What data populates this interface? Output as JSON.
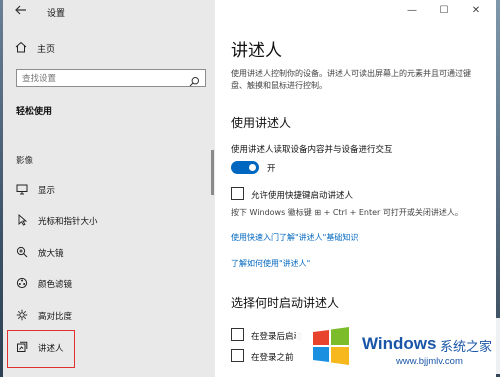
{
  "window": {
    "title": "设置",
    "controls": {
      "minimize": "—",
      "maximize": "☐",
      "close": "✕"
    }
  },
  "nav": {
    "home_label": "主页",
    "search_placeholder": "查找设置",
    "section_title": "轻松使用",
    "group_label": "影像",
    "items": [
      {
        "label": "显示",
        "icon": "display-icon"
      },
      {
        "label": "光标和指针大小",
        "icon": "cursor-icon"
      },
      {
        "label": "放大镜",
        "icon": "magnifier-icon"
      },
      {
        "label": "颜色滤镜",
        "icon": "color-filter-icon"
      },
      {
        "label": "高对比度",
        "icon": "high-contrast-icon"
      },
      {
        "label": "讲述人",
        "icon": "narrator-icon",
        "selected": true
      }
    ]
  },
  "content": {
    "title": "讲述人",
    "description": "使用讲述人控制你的设备。讲述人可读出屏幕上的元素并且可通过键盘、触摸和鼠标进行控制。",
    "section1_title": "使用讲述人",
    "toggle_description": "使用讲述人读取设备内容并与设备进行交互",
    "toggle_state": "开",
    "toggle_on": true,
    "shortcut_checkbox_label": "允许使用快捷键启动讲述人",
    "shortcut_checked": false,
    "shortcut_note": "按下 Windows 徽标键 ⊞ + Ctrl + Enter 可打开或关闭讲述人。",
    "link_quickstart": "使用快速入门了解\"讲述人\"基础知识",
    "link_learn_more": "了解如何使用\"讲述人\"",
    "section2_title": "选择何时启动讲述人",
    "startup_options": [
      {
        "label": "在登录后启动",
        "checked": false
      },
      {
        "label": "在登录之前",
        "checked": false
      }
    ]
  },
  "watermark": {
    "brand": "Windows",
    "cn": "系统之家",
    "url": "www.bjjmlv.com"
  },
  "colors": {
    "accent": "#0067c0",
    "nav_background": "#e9e9e9",
    "highlight_frame": "#e03030"
  }
}
